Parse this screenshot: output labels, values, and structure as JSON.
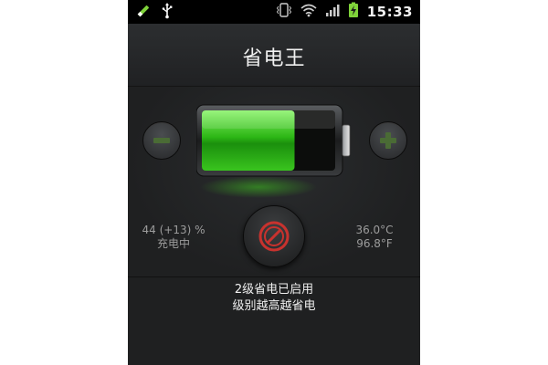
{
  "status_bar": {
    "time": "15:33",
    "left_icons": [
      "pen-icon",
      "usb-icon"
    ],
    "right_icons": [
      "vibrate-icon",
      "wifi-icon",
      "signal-icon",
      "battery-charging-icon"
    ]
  },
  "app": {
    "title": "省电王"
  },
  "battery": {
    "level_fraction": 0.44,
    "fill_color": "#33c21a",
    "status_text": "44 (+13) %",
    "charging_text": "充电中"
  },
  "temperature": {
    "celsius": "36.0°C",
    "fahrenheit": "96.8°F"
  },
  "controls": {
    "decrease_icon": "minus-icon",
    "increase_icon": "plus-icon",
    "power_icon": "power-saver-icon",
    "power_color": "#c8322e"
  },
  "mode": {
    "line1": "2级省电已启用",
    "line2": "级别越高越省电"
  }
}
